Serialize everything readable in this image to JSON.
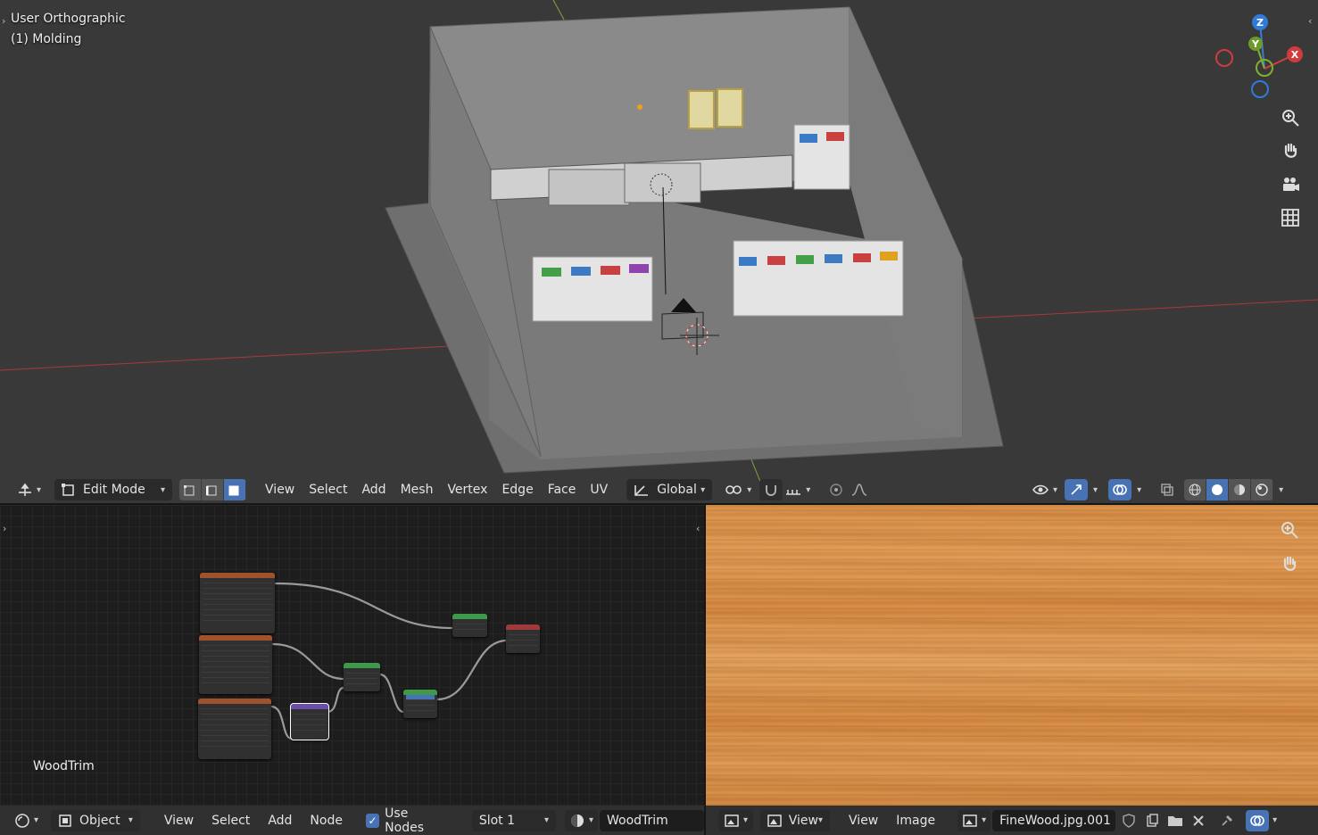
{
  "viewport": {
    "view_label": "User Orthographic",
    "object_label": "(1) Molding",
    "gizmo": {
      "z": "Z",
      "y": "Y",
      "x": "X"
    },
    "header": {
      "editor_type_icon": "editor-type-icon",
      "mode": "Edit Mode",
      "menus": [
        "View",
        "Select",
        "Add",
        "Mesh",
        "Vertex",
        "Edge",
        "Face",
        "UV"
      ],
      "transform_orientation": "Global"
    },
    "colors": {
      "background": "#393939",
      "x_axis": "#b43c3c",
      "y_axis": "#8ab33a",
      "accent": "#4772b3"
    }
  },
  "node_editor": {
    "material_label": "WoodTrim",
    "header": {
      "mode": "Object",
      "menus": [
        "View",
        "Select",
        "Add",
        "Node"
      ],
      "use_nodes_label": "Use Nodes",
      "slot": "Slot 1",
      "material": "WoodTrim"
    }
  },
  "image_editor": {
    "header": {
      "view_mode": "View",
      "menus": [
        "View",
        "Image"
      ],
      "image_name": "FineWood.jpg.001"
    }
  }
}
